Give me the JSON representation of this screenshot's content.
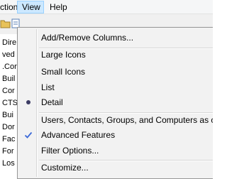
{
  "menubar": {
    "items": [
      {
        "label": "Action"
      },
      {
        "label": "View"
      },
      {
        "label": "Help"
      }
    ]
  },
  "tree": {
    "items": [
      "Dire",
      "ved C",
      ".Cor",
      "Buil",
      "Cor",
      "CTS",
      "Bui",
      "Dor",
      "Fac",
      "For",
      "Los"
    ]
  },
  "menu": {
    "add_remove_columns": "Add/Remove Columns...",
    "large_icons": "Large Icons",
    "small_icons": "Small Icons",
    "list": "List",
    "detail": "Detail",
    "users_contacts": "Users, Contacts, Groups, and Computers as containers",
    "advanced_features": "Advanced Features",
    "filter_options": "Filter Options...",
    "customize": "Customize...",
    "selected_view": "Detail",
    "advanced_features_checked": true,
    "mark_color": "#3c3c64",
    "check_color": "#3c6ad8"
  }
}
